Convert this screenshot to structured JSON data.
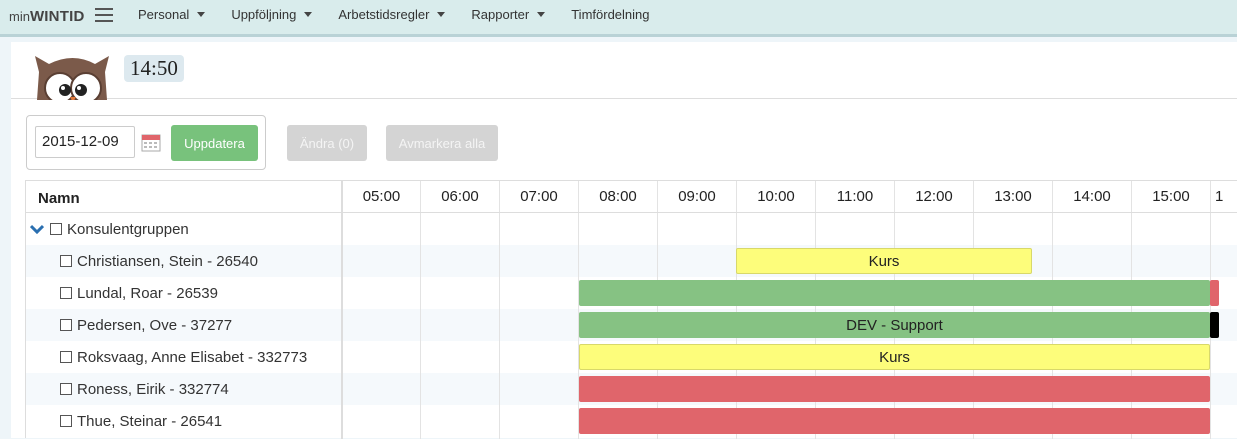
{
  "nav": {
    "brand_small": "min",
    "brand_big": "WINTID",
    "items": [
      {
        "label": "Personal",
        "dropdown": true
      },
      {
        "label": "Uppföljning",
        "dropdown": true
      },
      {
        "label": "Arbetstidsregler",
        "dropdown": true
      },
      {
        "label": "Rapporter",
        "dropdown": true
      },
      {
        "label": "Timfördelning",
        "dropdown": false
      }
    ]
  },
  "header": {
    "clock": "14:50"
  },
  "controls": {
    "date": "2015-12-09",
    "update_label": "Uppdatera",
    "andra_label": "Ändra (0)",
    "avmarkera_label": "Avmarkera alla"
  },
  "grid": {
    "name_header": "Namn",
    "hours": [
      "05:00",
      "06:00",
      "07:00",
      "08:00",
      "09:00",
      "10:00",
      "11:00",
      "12:00",
      "13:00",
      "14:00",
      "15:00",
      "1"
    ],
    "group": "Konsulentgruppen",
    "people": [
      "Christiansen, Stein - 26540",
      "Lundal, Roar - 26539",
      "Pedersen, Ove - 37277",
      "Roksvaag, Anne Elisabet - 332773",
      "Roness, Eirik - 332774",
      "Thue, Steinar - 26541"
    ],
    "bar_labels": {
      "christiansen": "Kurs",
      "pedersen": "DEV - Support",
      "roksvaag": "Kurs"
    }
  },
  "colors": {
    "nav_bg": "#d9ecec",
    "update_btn": "#78c27c",
    "bar_yellow": "#fdfd7b",
    "bar_green": "#86c283",
    "bar_red": "#e0656b",
    "cap_black": "#000000"
  }
}
